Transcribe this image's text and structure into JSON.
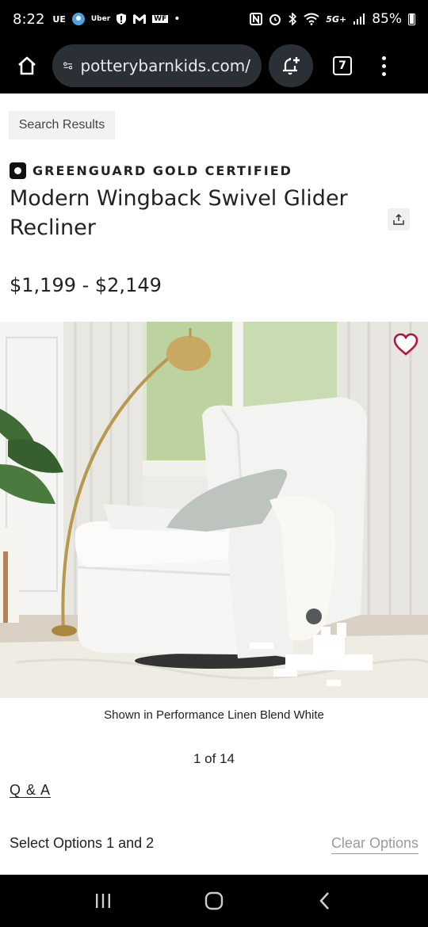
{
  "status_bar": {
    "time": "8:22",
    "left_icons": [
      "UE",
      "Uber",
      "shield-icon",
      "gmail-icon",
      "WF",
      "•"
    ],
    "battery": "85%",
    "network": "5G+"
  },
  "browser": {
    "url": "potterybarnkids.com/",
    "tab_count": "7"
  },
  "page": {
    "breadcrumb_button": "Search Results",
    "certification": "GREENGUARD GOLD CERTIFIED",
    "title": "Modern Wingback Swivel Glider Recliner",
    "price": "$1,199 - $2,149",
    "image_caption": "Shown in Performance Linen Blend White",
    "image_counter": "1 of 14",
    "qa_link": "Q & A",
    "select_options": "Select Options 1 and 2",
    "clear_options": "Clear Options"
  },
  "colors": {
    "heart": "#b5173b",
    "lamp_gold": "#b8974e",
    "chair_white": "#f6f6f4"
  }
}
